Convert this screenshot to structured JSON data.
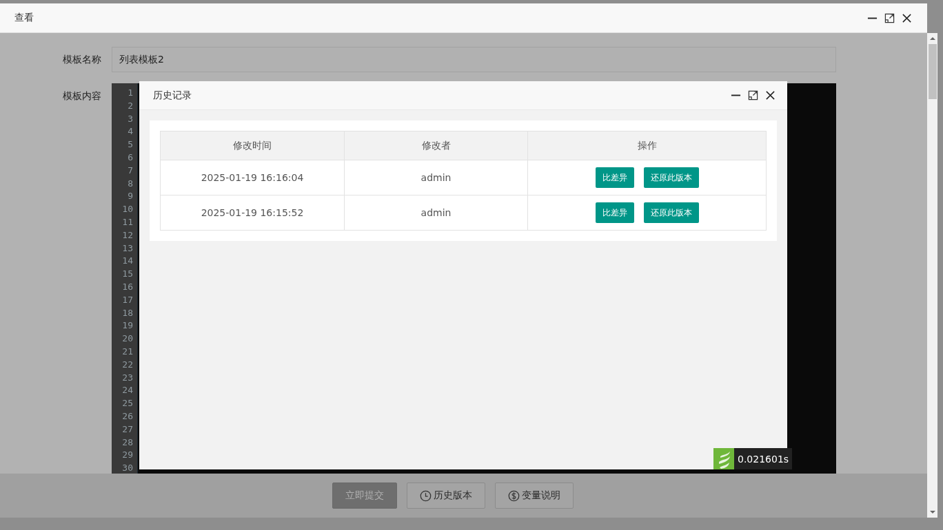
{
  "window": {
    "title": "查看"
  },
  "form": {
    "name_label": "模板名称",
    "name_value": "列表模板2",
    "content_label": "模板内容"
  },
  "editor": {
    "line_numbers": [
      "1",
      "2",
      "3",
      "4",
      "5",
      "6",
      "7",
      "8",
      "9",
      "10",
      "11",
      "12",
      "13",
      "14",
      "15",
      "16",
      "17",
      "18",
      "19",
      "20",
      "21",
      "22",
      "23",
      "24",
      "25",
      "26",
      "27",
      "28",
      "29",
      "30"
    ]
  },
  "footer": {
    "buttons": [
      {
        "label": "立即提交",
        "kind": "primary"
      },
      {
        "label": "历史版本",
        "kind": "clock"
      },
      {
        "label": "变量说明",
        "kind": "dollar"
      }
    ]
  },
  "dialog": {
    "title": "历史记录",
    "table": {
      "columns": [
        "修改时间",
        "修改者",
        "操作"
      ],
      "rows": [
        {
          "time": "2025-01-19 16:16:04",
          "user": "admin",
          "actions": [
            "比差异",
            "还原此版本"
          ]
        },
        {
          "time": "2025-01-19 16:15:52",
          "user": "admin",
          "actions": [
            "比差异",
            "还原此版本"
          ]
        }
      ]
    }
  },
  "timer": {
    "text": "0.021601s"
  }
}
